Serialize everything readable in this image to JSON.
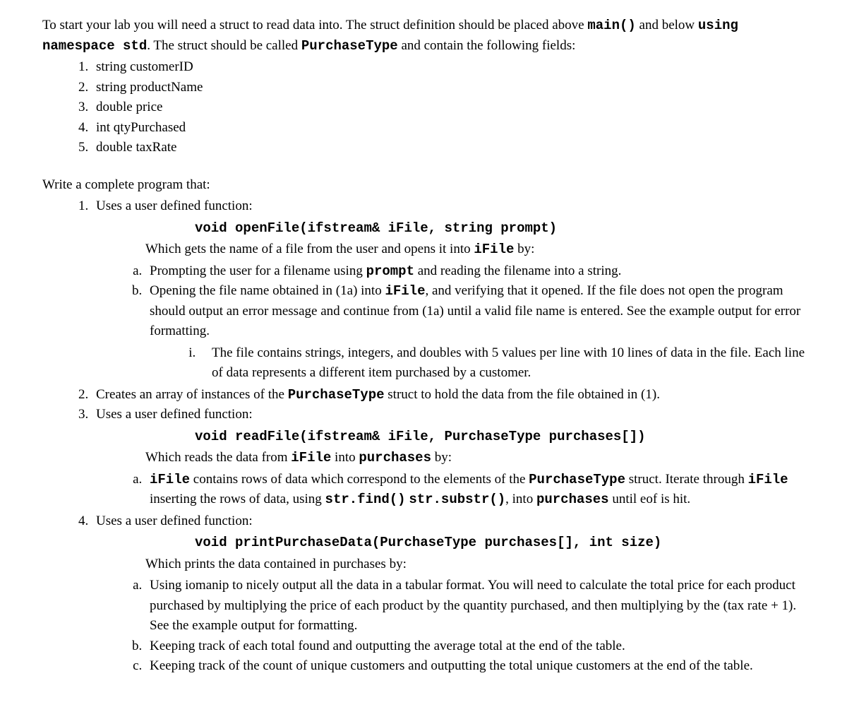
{
  "intro": {
    "part1": "To start your lab you will need a struct to read data into. The struct definition should be placed above ",
    "code1": "main()",
    "part2": " and below ",
    "code2": "using namespace std",
    "part3": ". The struct should be called ",
    "code3": "PurchaseType",
    "part4": " and contain the following fields:"
  },
  "fields": {
    "f1": "string customerID",
    "f2": "string productName",
    "f3": "double price",
    "f4": "int qtyPurchased",
    "f5": "double taxRate"
  },
  "write_complete": "Write a complete program that:",
  "item1": {
    "lead": "Uses a user defined function:",
    "sig": "void openFile(ifstream& iFile, string prompt)",
    "which1": "Which gets the name of a file from the user and opens it into ",
    "which_code": "iFile",
    "which2": " by:",
    "a1": "Prompting the user for a filename using ",
    "a_code": "prompt",
    "a2": " and reading the filename into a string.",
    "b1": "Opening the file name obtained in (1a) into ",
    "b_code": "iFile",
    "b2": ", and verifying that it opened.  If the file does not open the program should output an error message and continue from (1a) until a valid file name is entered. See the example output for error formatting.",
    "i_text": "The file contains strings, integers, and doubles with 5 values per line with 10 lines of data in the file. Each line of data represents a different item purchased by a customer."
  },
  "item2": {
    "t1": "Creates an array of instances of the ",
    "code": "PurchaseType",
    "t2": " struct to hold the data from the file obtained in (1)."
  },
  "item3": {
    "lead": "Uses a user defined function:",
    "sig": "void readFile(ifstream& iFile, PurchaseType purchases[])",
    "which1": "Which reads the data from ",
    "code1": "iFile",
    "which2": " into ",
    "code2": "purchases",
    "which3": " by:",
    "a_code1": "iFile",
    "a_t1": " contains rows of data which correspond to the elements of the ",
    "a_code2": "PurchaseType",
    "a_t2": " struct. Iterate through ",
    "a_code3": "iFile",
    "a_t3": " inserting the rows of data, using ",
    "a_code4": "str.find()",
    "a_sp": " ",
    "a_code5": "str.substr()",
    "a_t4": ", into ",
    "a_code6": "purchases",
    "a_t5": " until eof is hit."
  },
  "item4": {
    "lead": "Uses a user defined function:",
    "sig": "void printPurchaseData(PurchaseType purchases[], int size)",
    "which": "Which prints the data contained in purchases by:",
    "a": "Using iomanip to nicely output all the data in a tabular format. You will need to calculate the total price for each product purchased by multiplying the price of each product by the quantity purchased, and then multiplying by the (tax rate + 1). See the example output for formatting.",
    "b": "Keeping track of each total found and outputting the average total at the end of the table.",
    "c": "Keeping track of the count of unique customers and outputting the total unique customers at the end of the table."
  }
}
